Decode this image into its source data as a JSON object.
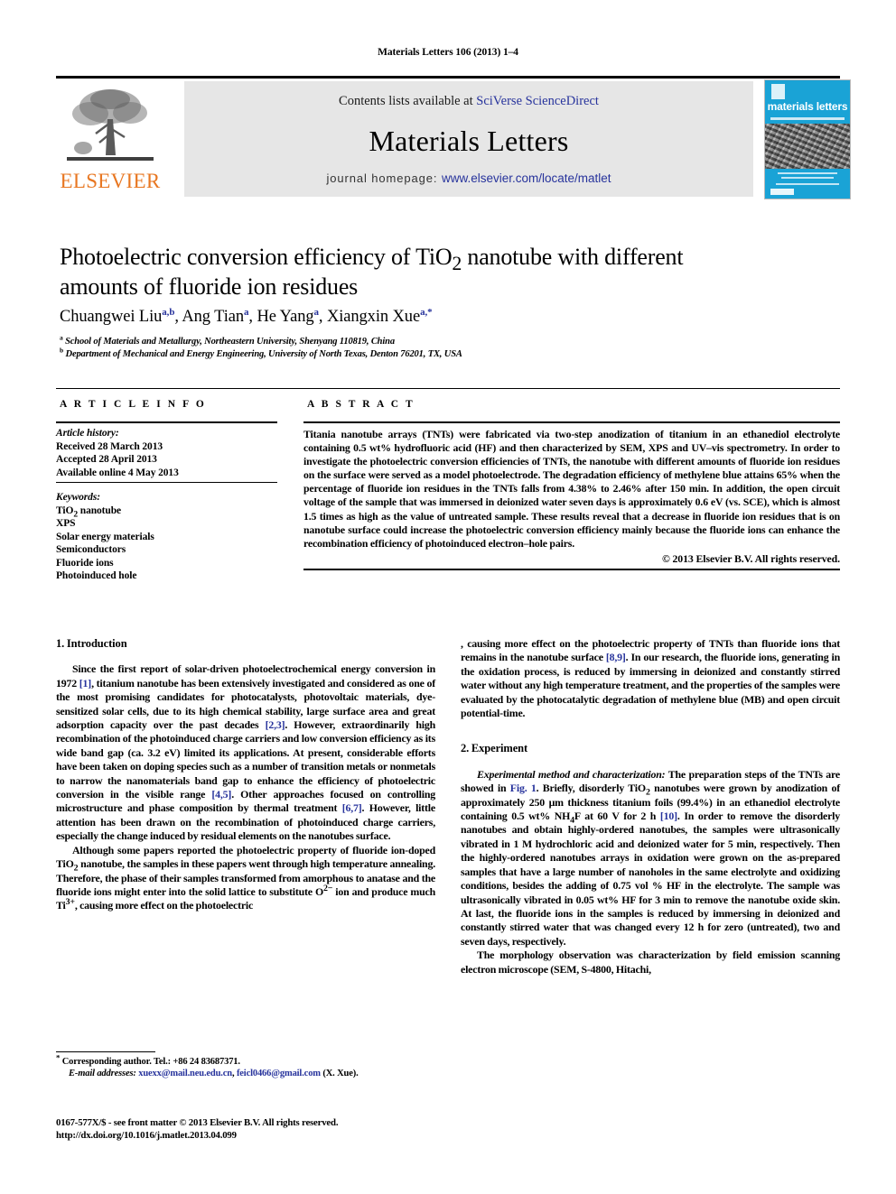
{
  "running_head": "Materials Letters 106 (2013) 1–4",
  "masthead": {
    "publisher_name": "ELSEVIER",
    "contents_prefix": "Contents lists available at ",
    "contents_link": "SciVerse ScienceDirect",
    "journal_title": "Materials Letters",
    "homepage_label": "journal homepage: ",
    "homepage_url": "www.elsevier.com/locate/matlet",
    "cover_title": "materials letters",
    "accent_orange": "#E87722",
    "link_blue": "#27339c",
    "cover_blue": "#1aa3d6"
  },
  "article": {
    "title_line1": "Photoelectric conversion efficiency of TiO",
    "title_sub": "2",
    "title_line1b": " nanotube with different",
    "title_line2": "amounts of fluoride ion residues",
    "authors": [
      {
        "name": "Chuangwei Liu",
        "marks": "a,b",
        "sep": ", "
      },
      {
        "name": "Ang Tian",
        "marks": "a",
        "sep": ", "
      },
      {
        "name": "He Yang",
        "marks": "a",
        "sep": ", "
      },
      {
        "name": "Xiangxin Xue",
        "marks": "a,*",
        "sep": ""
      }
    ],
    "affiliations": [
      {
        "mark": "a",
        "text": "School of Materials and Metallurgy, Northeastern University, Shenyang 110819, China"
      },
      {
        "mark": "b",
        "text": "Department of Mechanical and Energy Engineering, University of North Texas, Denton 76201, TX, USA"
      }
    ]
  },
  "article_info": {
    "heading": "A R T I C L E   I N F O",
    "history_label": "Article history:",
    "history": [
      "Received 28 March 2013",
      "Accepted 28 April 2013",
      "Available online 4 May 2013"
    ],
    "keywords_label": "Keywords:",
    "keywords": [
      "TiO2 nanotube",
      "XPS",
      "Solar energy materials",
      "Semiconductors",
      "Fluoride ions",
      "Photoinduced hole"
    ]
  },
  "abstract": {
    "heading": "A B S T R A C T",
    "text": "Titania nanotube arrays (TNTs) were fabricated via two-step anodization of titanium in an ethanediol electrolyte containing 0.5 wt% hydrofluoric acid (HF) and then characterized by SEM, XPS and UV–vis spectrometry. In order to investigate the photoelectric conversion efficiencies of TNTs, the nanotube with different amounts of fluoride ion residues on the surface were served as a model photoelectrode. The degradation efficiency of methylene blue attains 65% when the percentage of fluoride ion residues in the TNTs falls from 4.38% to 2.46% after 150 min. In addition, the open circuit voltage of the sample that was immersed in deionized water seven days is approximately 0.6 eV (vs. SCE), which is almost 1.5 times as high as the value of untreated sample. These results reveal that a decrease in fluoride ion residues that is on nanotube surface could increase the photoelectric conversion efficiency mainly because the fluoride ions can enhance the recombination efficiency of photoinduced electron–hole pairs.",
    "copyright": "© 2013 Elsevier B.V. All rights reserved."
  },
  "body": {
    "section1_heading": "1.  Introduction",
    "section2_heading": "2.  Experiment",
    "p1_a": "Since the first report of solar-driven photoelectrochemical energy conversion in 1972 ",
    "p1_ref1": "[1]",
    "p1_b": ", titanium nanotube has been extensively investigated and considered as one of the most promising candidates for photocatalysts, photovoltaic materials, dye-sensitized solar cells, due to its high chemical stability, large surface area and great adsorption capacity over the past decades ",
    "p1_ref2": "[2,3]",
    "p1_c": ". However, extraordinarily high recombination of the photoinduced charge carriers and low conversion efficiency as its wide band gap (ca. 3.2 eV) limited its applications. At present, considerable efforts have been taken on doping species such as a number of transition metals or nonmetals to narrow the nanomaterials band gap to enhance the efficiency of photoelectric conversion in the visible range ",
    "p1_ref3": "[4,5]",
    "p1_d": ". Other approaches focused on controlling microstructure and phase composition by thermal treatment ",
    "p1_ref4": "[6,7]",
    "p1_e": ". However, little attention has been drawn on the recombination of photoinduced charge carriers, especially the change induced by residual elements on the nanotubes surface.",
    "p2_a": "Although some papers reported the photoelectric property of fluoride ion-doped TiO",
    "p2_b": " nanotube, the samples in these papers went through high temperature annealing. Therefore, the phase of their samples transformed from amorphous to anatase and the fluoride ions might enter into the solid lattice to substitute O",
    "p2_c": " ion and produce much Ti",
    "p2_d": ", causing more effect on the photoelectric property of TNTs than fluoride ions that remains in the nanotube surface ",
    "p2_ref": "[8,9]",
    "p2_e": ". In our research, the fluoride ions, generating in the oxidation process, is reduced by immersing in deionized and constantly stirred water without any high temperature treatment, and the properties of the samples were evaluated by the photocatalytic degradation of methylene blue (MB) and open circuit potential-time.",
    "p3_italic": "Experimental method and characterization:",
    "p3_a": " The preparation steps of the TNTs are showed in ",
    "p3_fig": "Fig. 1",
    "p3_b": ". Briefly, disorderly TiO",
    "p3_c": " nanotubes were grown by anodization of approximately 250 μm thickness titanium foils (99.4%) in an ethanediol electrolyte containing 0.5 wt% NH",
    "p3_d": "F at 60 V for 2 h ",
    "p3_ref": "[10]",
    "p3_e": ". In order to remove the disorderly nanotubes and obtain highly-ordered nanotubes, the samples were ultrasonically vibrated in 1 M hydrochloric acid and deionized water for 5 min, respectively. Then the highly-ordered nanotubes arrays in oxidation were grown on the as-prepared samples that have a large number of nanoholes in the same electrolyte and oxidizing conditions, besides the adding of 0.75 vol % HF in the electrolyte. The sample was ultrasonically vibrated in 0.05 wt% HF for 3 min to remove the nanotube oxide skin. At last, the fluoride ions in the samples is reduced by immersing in deionized and constantly stirred water that was changed every 12 h for zero (untreated), two and seven days, respectively.",
    "p4": "The morphology observation was characterization by field emission scanning electron microscope (SEM, S-4800, Hitachi,"
  },
  "footnotes": {
    "corresponding": "Corresponding author. Tel.: +86 24 83687371.",
    "email_label": "E-mail addresses:",
    "email_1": "xuexx@mail.neu.edu.cn",
    "email_sep": ", ",
    "email_2": "feicl0466@gmail.com",
    "email_suffix": " (X. Xue)."
  },
  "imprint": {
    "line1": "0167-577X/$ - see front matter © 2013 Elsevier B.V. All rights reserved.",
    "line2": "http://dx.doi.org/10.1016/j.matlet.2013.04.099"
  }
}
